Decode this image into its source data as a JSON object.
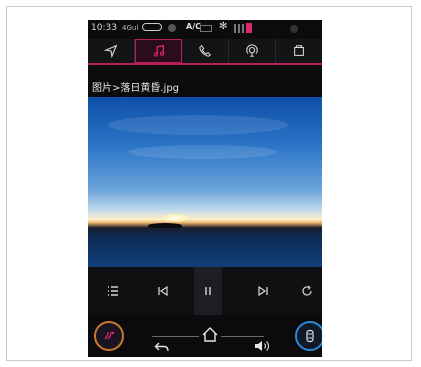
{
  "status_bar": {
    "time": "10:33",
    "signal_text": "4Gul",
    "ac_text": "A/C",
    "accent_color": "#e0266a"
  },
  "nav": {
    "tabs": [
      {
        "icon": "navigation-arrow-icon",
        "active": false
      },
      {
        "icon": "music-note-icon",
        "active": true
      },
      {
        "icon": "phone-icon",
        "active": false
      },
      {
        "icon": "radio-icon",
        "active": false
      },
      {
        "icon": "apps-icon",
        "active": false
      }
    ],
    "accent_color": "#b81e58"
  },
  "breadcrumb": {
    "path": "图片>落日黄昏.jpg"
  },
  "viewer": {
    "image_description_icon": "sunset-photo"
  },
  "controls": {
    "items": [
      "list-icon",
      "previous-icon",
      "pause-icon",
      "next-icon",
      "rotate-icon"
    ]
  },
  "bottom_bar": {
    "left_icon": "fan-speed-icon",
    "right_icon": "car-icon",
    "home_icon": "home-icon",
    "back_icon": "back-arrow-icon",
    "volume_icon": "volume-icon"
  }
}
